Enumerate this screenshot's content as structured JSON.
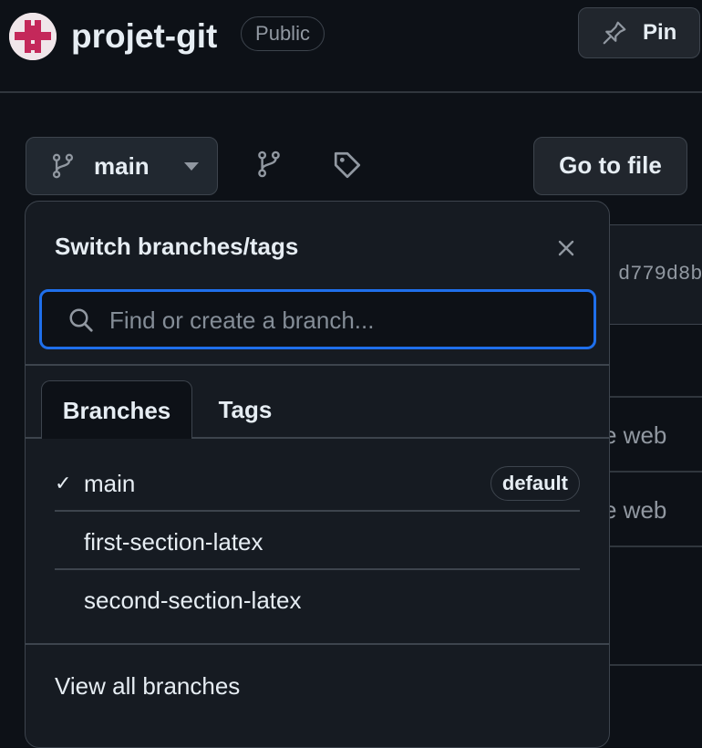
{
  "header": {
    "repo_name": "projet-git",
    "visibility": "Public",
    "pin_label": "Pin"
  },
  "toolbar": {
    "branch_name": "main",
    "go_to_file": "Go to file"
  },
  "background": {
    "commit_hash": "d779d8b",
    "row1_text": "e web",
    "row2_text": "e web"
  },
  "dropdown": {
    "title": "Switch branches/tags",
    "search_placeholder": "Find or create a branch...",
    "tabs": [
      {
        "label": "Branches",
        "active": true
      },
      {
        "label": "Tags",
        "active": false
      }
    ],
    "branches": [
      {
        "name": "main",
        "selected": true,
        "badge": "default"
      },
      {
        "name": "first-section-latex",
        "selected": false
      },
      {
        "name": "second-section-latex",
        "selected": false
      }
    ],
    "view_all_label": "View all branches"
  },
  "colors": {
    "background": "#0d1117",
    "accent": "#1f6feb",
    "avatar_brand": "#c4285a"
  }
}
